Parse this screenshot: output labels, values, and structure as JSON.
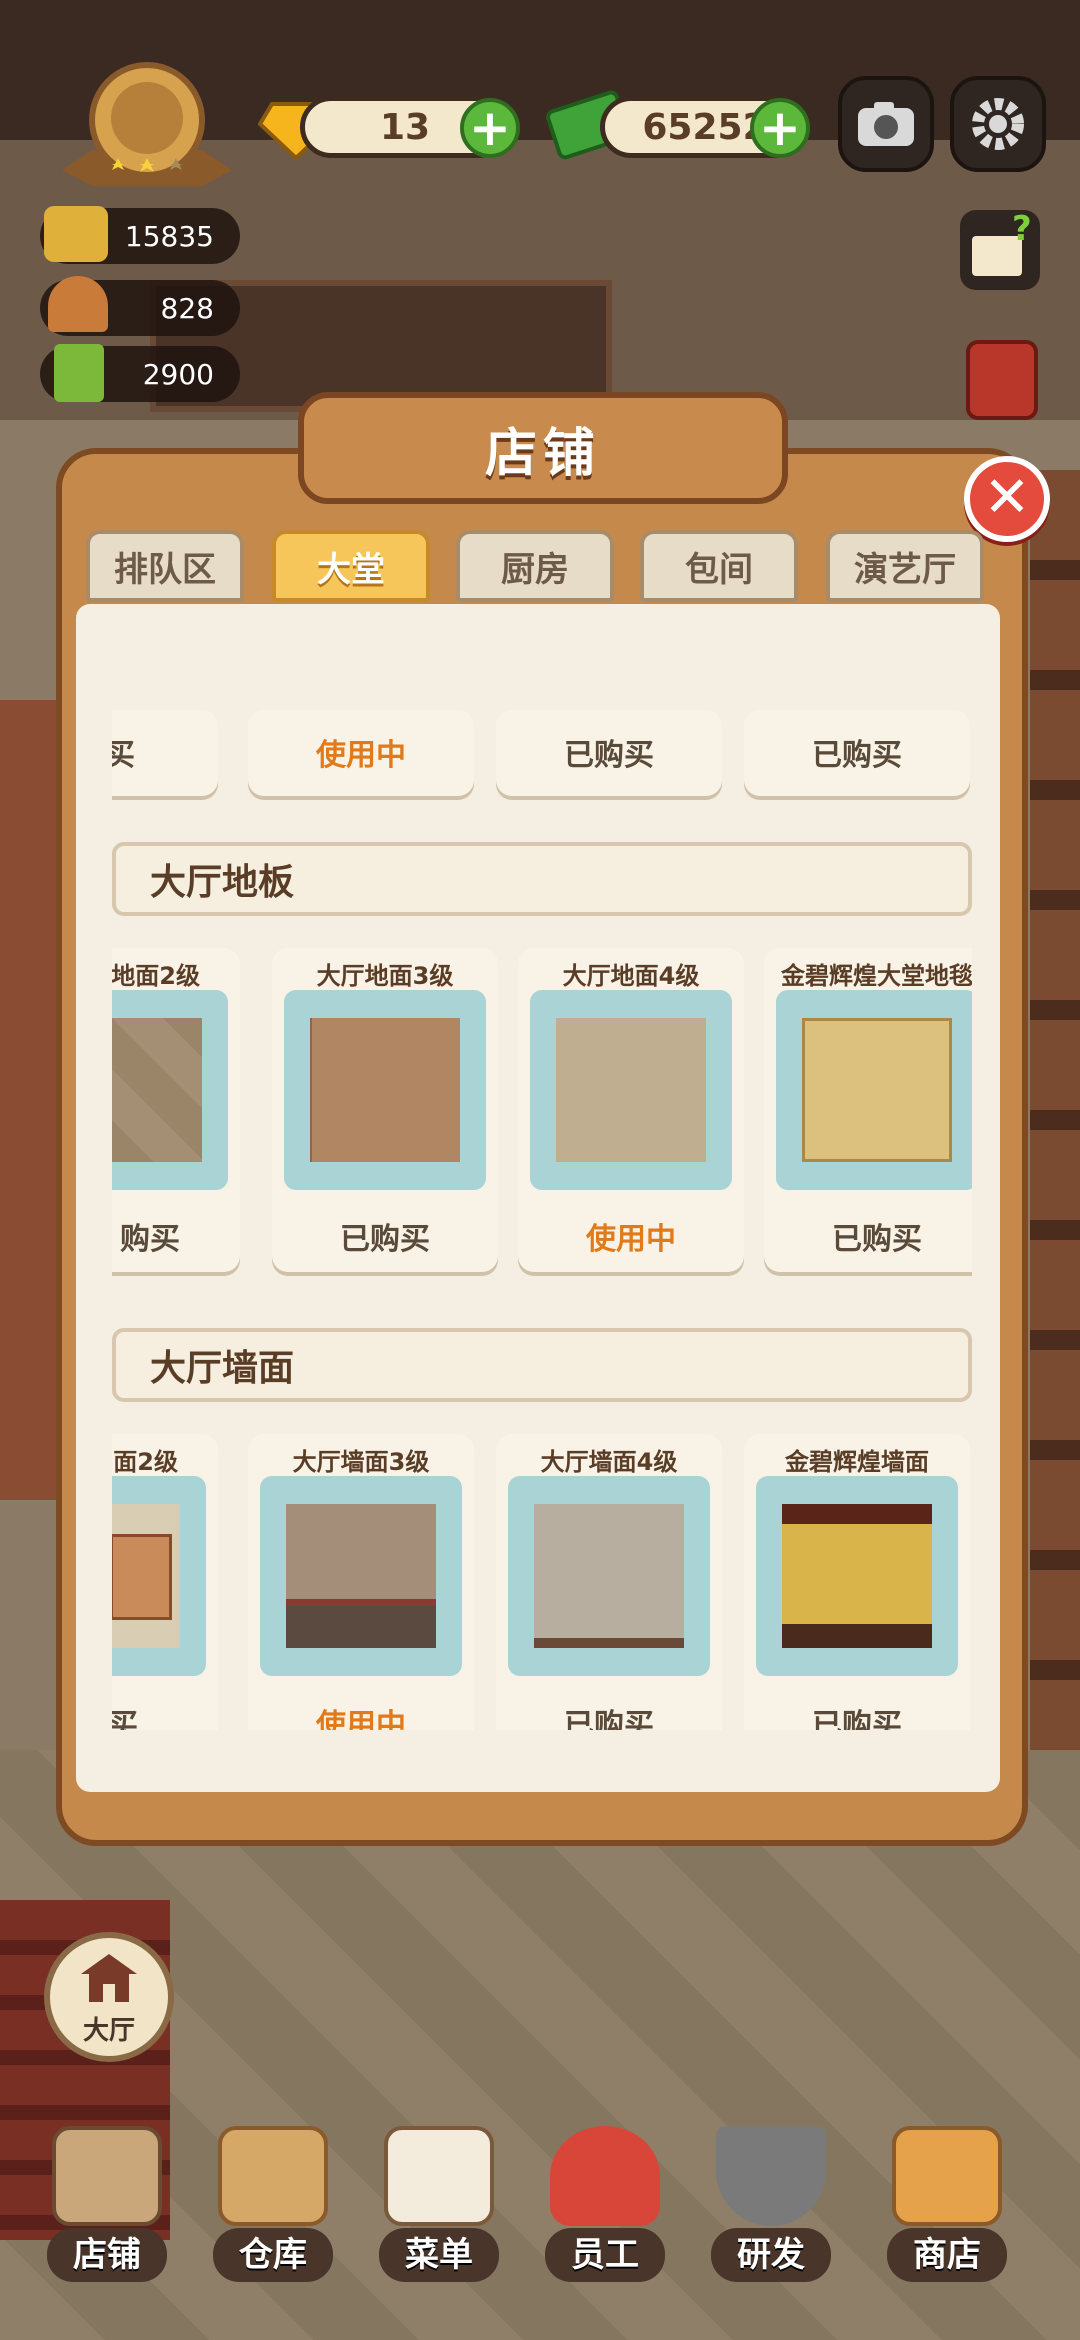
{
  "hud": {
    "gems": "13",
    "cash": "65252",
    "stat1": "15835",
    "stat2": "828",
    "stat3": "2900",
    "plus": "+"
  },
  "panel": {
    "title": "店铺",
    "close": "✕",
    "tabs": [
      {
        "label": "排队区",
        "active": false
      },
      {
        "label": "大堂",
        "active": true
      },
      {
        "label": "厨房",
        "active": false
      },
      {
        "label": "包间",
        "active": false
      },
      {
        "label": "演艺厅",
        "active": false
      }
    ],
    "top_row": [
      {
        "status": "购买"
      },
      {
        "status": "使用中"
      },
      {
        "status": "已购买"
      },
      {
        "status": "已购买"
      }
    ],
    "floor_section": {
      "title": "大厅地板",
      "items": [
        {
          "name": "地面2级",
          "status": "购买"
        },
        {
          "name": "大厅地面3级",
          "status": "已购买"
        },
        {
          "name": "大厅地面4级",
          "status": "使用中"
        },
        {
          "name": "金碧辉煌大堂地毯",
          "status": "已购买"
        }
      ]
    },
    "wall_section": {
      "title": "大厅墙面",
      "items": [
        {
          "name": "面2级",
          "status": "购买"
        },
        {
          "name": "大厅墙面3级",
          "status": "使用中"
        },
        {
          "name": "大厅墙面4级",
          "status": "已购买"
        },
        {
          "name": "金碧辉煌墙面",
          "status": "已购买"
        }
      ]
    }
  },
  "side": {
    "hall_label": "大厅"
  },
  "nav": [
    {
      "label": "店铺"
    },
    {
      "label": "仓库"
    },
    {
      "label": "菜单"
    },
    {
      "label": "员工"
    },
    {
      "label": "研发"
    },
    {
      "label": "商店"
    }
  ],
  "colors": {
    "accent_orange": "#e07a1a",
    "tab_active": "#f7c65a",
    "close_red": "#e44b3c",
    "plus_green": "#5cb83a"
  }
}
